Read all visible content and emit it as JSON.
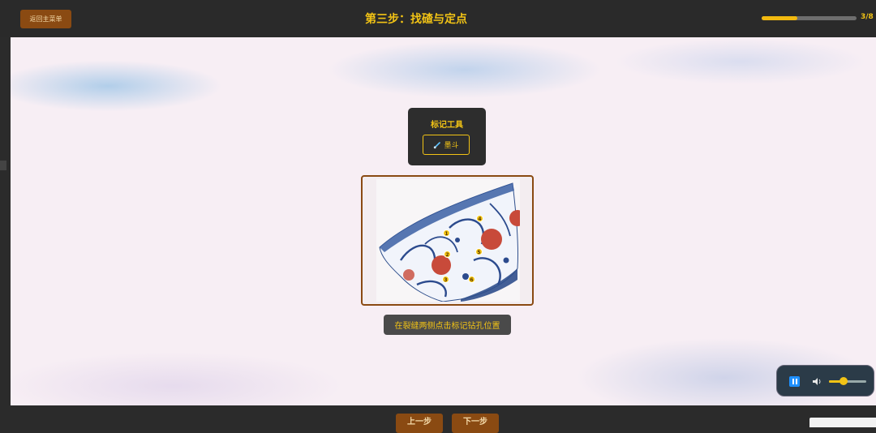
{
  "header": {
    "back_label": "返回主菜单",
    "title": "第三步：找碴与定点",
    "progress_text": "3/8",
    "progress_fraction": 0.375
  },
  "tool_panel": {
    "title": "标记工具",
    "tool_icon": "brush-icon",
    "tool_label": "墨斗"
  },
  "image": {
    "markers": [
      "1",
      "2",
      "3",
      "4",
      "5",
      "6"
    ]
  },
  "hint": "在裂缝两侧点击标记钻孔位置",
  "audio": {
    "state": "playing",
    "volume": 0.4
  },
  "footer": {
    "prev_label": "上一步",
    "next_label": "下一步"
  },
  "colors": {
    "accent": "#f2c315",
    "button_brown": "#8a4a12",
    "header_bg": "#2a2a2a"
  }
}
